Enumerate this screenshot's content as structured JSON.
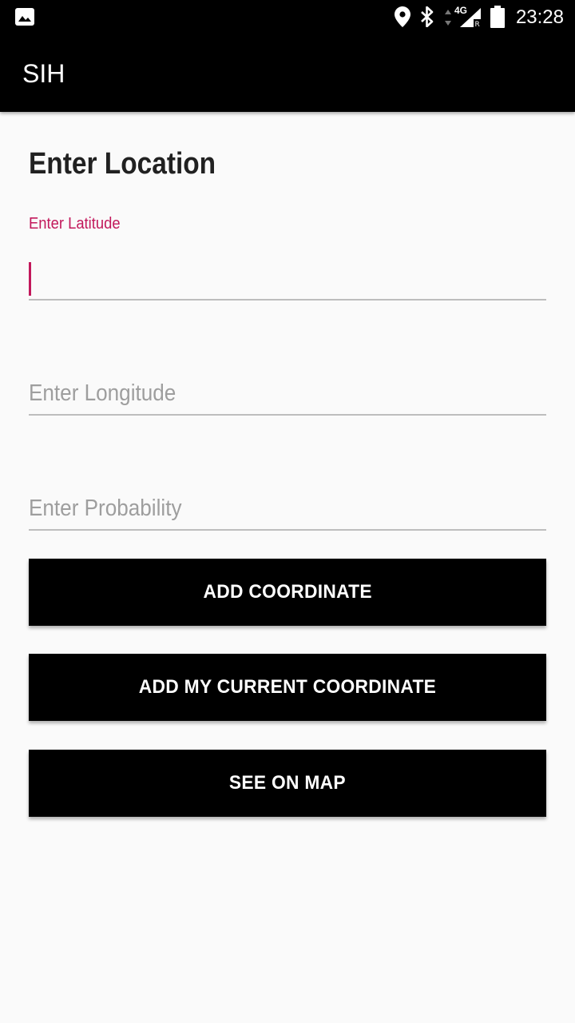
{
  "status_bar": {
    "time": "23:28",
    "network_label": "4G",
    "icons": [
      "image-icon",
      "location-pin-icon",
      "bluetooth-icon",
      "data-arrows-icon",
      "signal-icon",
      "battery-icon"
    ]
  },
  "app_bar": {
    "title": "SIH"
  },
  "form": {
    "heading": "Enter Location",
    "latitude": {
      "label": "Enter Latitude",
      "value": ""
    },
    "longitude": {
      "placeholder": "Enter Longitude",
      "value": ""
    },
    "probability": {
      "placeholder": "Enter Probability",
      "value": ""
    }
  },
  "buttons": {
    "add_coordinate": "ADD COORDINATE",
    "add_current_coordinate": "ADD MY CURRENT COORDINATE",
    "see_on_map": "SEE ON MAP"
  },
  "colors": {
    "accent": "#c2185b",
    "primary": "#000000",
    "background": "#fafafa"
  }
}
